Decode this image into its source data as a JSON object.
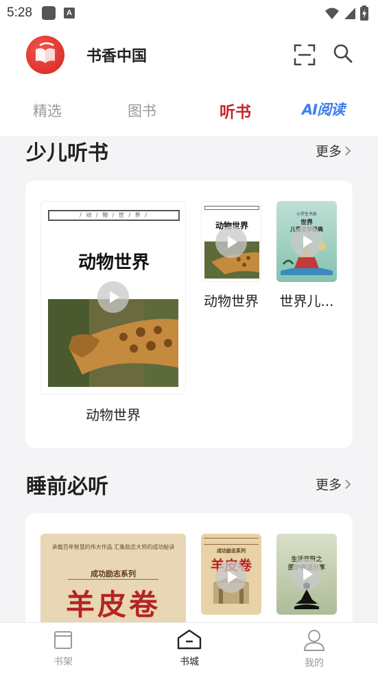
{
  "status_bar": {
    "time": "5:28"
  },
  "header": {
    "app_title": "书香中国"
  },
  "tabs": [
    {
      "label": "精选"
    },
    {
      "label": "图书"
    },
    {
      "label": "听书"
    },
    {
      "label": "AI阅读"
    }
  ],
  "sections": [
    {
      "title": "少儿听书",
      "more_label": "更多",
      "books": [
        {
          "title": "动物世界",
          "cover_text": "动物世界",
          "series_text": "/ 动 / 物 / 世 / 界 /"
        },
        {
          "title": "动物世界",
          "cover_text": "动物世界"
        },
        {
          "title": "世界儿...",
          "cover_top": "小学生书系",
          "cover_title": "世界",
          "cover_subtitle": "儿童文学经典"
        }
      ]
    },
    {
      "title": "睡前必听",
      "more_label": "更多",
      "books": [
        {
          "cover_tagline": "承载百年智慧的伟大作品  汇集励志大师的成功秘诀",
          "series": "成功励志系列",
          "cover_title": "羊皮卷"
        },
        {
          "series": "成功励志系列",
          "cover_title": "羊皮卷"
        },
        {
          "cover_title": "生活音符之",
          "cover_subtitle": "围炉夜话分享"
        }
      ]
    }
  ],
  "bottom_nav": [
    {
      "label": "书架"
    },
    {
      "label": "书城"
    },
    {
      "label": "我的"
    }
  ]
}
